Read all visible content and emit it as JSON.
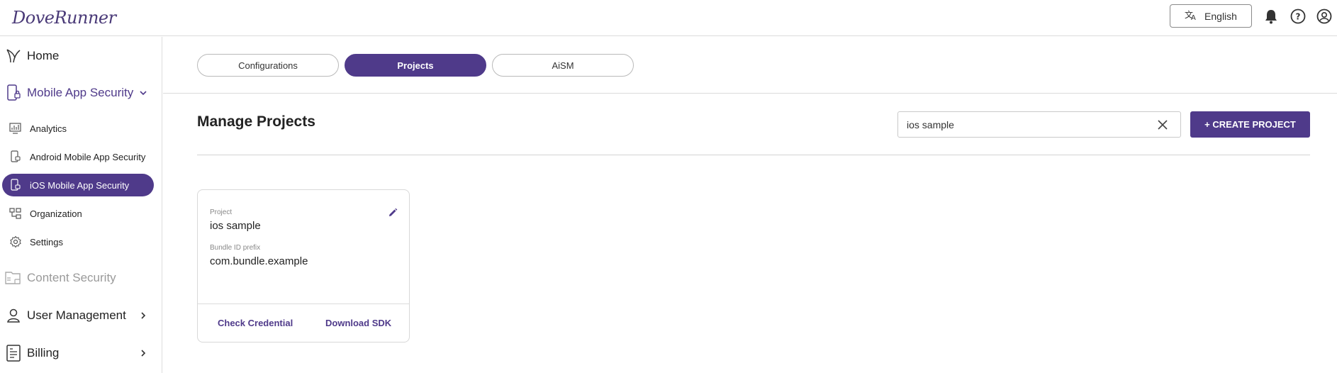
{
  "header": {
    "logo": "DoveRunner",
    "language_label": "English",
    "icons": [
      "translate-icon",
      "bell-icon",
      "help-icon",
      "account-icon"
    ]
  },
  "sidebar": {
    "home": "Home",
    "mobile_app_security": "Mobile App Security",
    "sub_items": [
      {
        "label": "Analytics",
        "icon": "analytics-icon"
      },
      {
        "label": "Android Mobile App Security",
        "icon": "android-app-icon"
      },
      {
        "label": "iOS Mobile App Security",
        "icon": "ios-app-icon"
      },
      {
        "label": "Organization",
        "icon": "organization-icon"
      },
      {
        "label": "Settings",
        "icon": "gear-icon"
      }
    ],
    "content_security": "Content Security",
    "user_management": "User Management",
    "billing": "Billing"
  },
  "tabs": [
    "Configurations",
    "Projects",
    "AiSM"
  ],
  "main": {
    "title": "Manage Projects",
    "search_value": "ios sample",
    "create_button": "+ CREATE PROJECT"
  },
  "card": {
    "project_label": "Project",
    "project_name": "ios sample",
    "bundle_label": "Bundle ID prefix",
    "bundle_value": "com.bundle.example",
    "check_credential": "Check Credential",
    "download_sdk": "Download SDK"
  },
  "colors": {
    "accent": "#4f3a8a",
    "disabled_text": "#9a9a9a"
  }
}
